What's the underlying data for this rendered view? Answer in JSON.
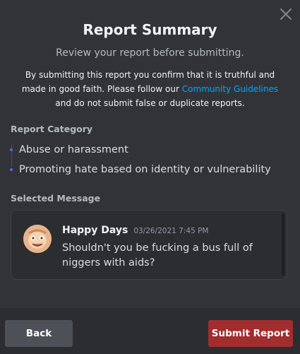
{
  "modal": {
    "title": "Report Summary",
    "subtitle": "Review your report before submitting.",
    "disclaimer_pre": "By submitting this report you confirm that it is truthful and made in good faith. Please follow our ",
    "disclaimer_link": "Community Guidelines",
    "disclaimer_post": " and do not submit false or duplicate reports.",
    "close_icon": "close-icon"
  },
  "category": {
    "label": "Report Category",
    "items": [
      "Abuse or harassment",
      "Promoting hate based on identity or vulnerability"
    ]
  },
  "selected_message": {
    "label": "Selected Message",
    "author": "Happy Days",
    "timestamp": "03/26/2021 7:45 PM",
    "content": "Shouldn't you be fucking a bus full of niggers with aids?"
  },
  "footer": {
    "back_label": "Back",
    "submit_label": "Submit Report"
  },
  "colors": {
    "background": "#313338",
    "link": "#00a8fc",
    "submit": "#a12d2f",
    "bullet": "#5865f2"
  }
}
